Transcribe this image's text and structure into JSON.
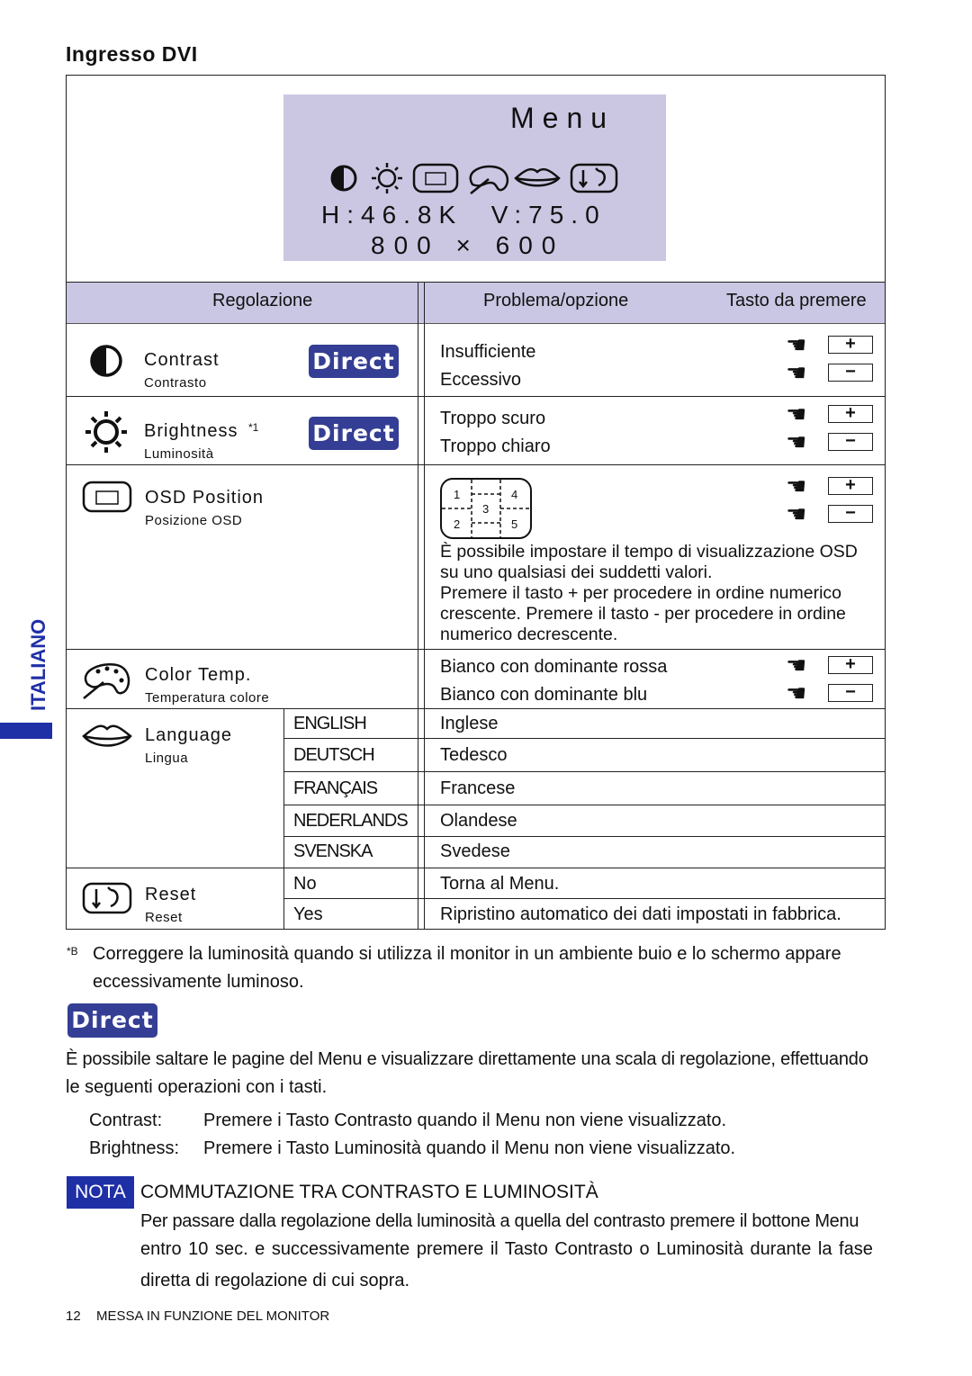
{
  "section_title": "Ingresso DVI",
  "side_tab": "ITALIANO",
  "menu": {
    "title": "Menu",
    "freq": "H:46.8K  V:75.0",
    "resolution": "800 × 600",
    "icons": [
      "contrast-icon",
      "brightness-icon",
      "osd-position-icon",
      "color-temp-icon",
      "language-icon",
      "reset-icon"
    ]
  },
  "table": {
    "headers": {
      "adjustment": "Regolazione",
      "problem": "Problema/opzione",
      "key": "Tasto da premere"
    },
    "direct_label": "Direct",
    "rows": [
      {
        "name": "Contrast",
        "sub": "Contrasto",
        "options": [
          "Insufficiente",
          "Eccessivo"
        ],
        "keys": [
          "+",
          "−"
        ]
      },
      {
        "name": "Brightness",
        "note": "*1",
        "sub": "Luminosità",
        "options": [
          "Troppo scuro",
          "Troppo chiaro"
        ],
        "keys": [
          "+",
          "−"
        ]
      },
      {
        "name": "OSD Position",
        "sub": "Posizione OSD",
        "grid": [
          "1",
          "2",
          "3",
          "4",
          "5"
        ],
        "keys": [
          "+",
          "−"
        ],
        "description": [
          "È possibile impostare il tempo di visualizzazione OSD",
          "su uno qualsiasi dei suddetti valori.",
          "Premere il tasto + per procedere in ordine numerico",
          "crescente. Premere il tasto - per procedere in ordine",
          "numerico decrescente."
        ]
      },
      {
        "name": "Color Temp.",
        "sub": "Temperatura colore",
        "options": [
          "Bianco con dominante rossa",
          "Bianco con dominante blu"
        ],
        "keys": [
          "+",
          "−"
        ]
      },
      {
        "name": "Language",
        "sub": "Lingua",
        "choices": [
          [
            "ENGLISH",
            "Inglese"
          ],
          [
            "DEUTSCH",
            "Tedesco"
          ],
          [
            "FRANÇAIS",
            "Francese"
          ],
          [
            "NEDERLANDS",
            "Olandese"
          ],
          [
            "SVENSKA",
            "Svedese"
          ]
        ]
      },
      {
        "name": "Reset",
        "sub": "Reset",
        "choices": [
          [
            "No",
            "Torna al Menu."
          ],
          [
            "Yes",
            "Ripristino automatico dei dati impostati in fabbrica."
          ]
        ]
      }
    ]
  },
  "footnote": {
    "mark": "*B",
    "text1": "Correggere la luminosità quando si utilizza il monitor in un ambiente buio e lo schermo appare",
    "text2": "eccessivamente luminoso."
  },
  "direct_section": {
    "badge": "Direct",
    "text1": "È possibile saltare le pagine del Menu e visualizzare direttamente una scala di regolazione, effettuando",
    "text2": "le seguenti operazioni con i tasti.",
    "items": [
      {
        "label": "Contrast:",
        "text": "Premere i Tasto Contrasto quando il Menu non viene visualizzato."
      },
      {
        "label": "Brightness:",
        "text": "Premere i Tasto Luminosità quando il Menu non viene visualizzato."
      }
    ]
  },
  "nota": {
    "badge": "NOTA",
    "title": "COMMUTAZIONE TRA CONTRASTO E LUMINOSITÀ",
    "lines": [
      "Per passare dalla regolazione della luminosità a quella del contrasto premere il bottone Menu",
      "entro 10 sec. e successivamente premere il Tasto Contrasto o Luminosità durante la fase",
      "diretta di regolazione di cui sopra."
    ]
  },
  "footer": {
    "page": "12",
    "text": "MESSA IN FUNZIONE DEL MONITOR"
  },
  "colors": {
    "accent": "#343e94",
    "header_bg": "#c9c7e3",
    "menu_bg": "#cbc7e3"
  }
}
